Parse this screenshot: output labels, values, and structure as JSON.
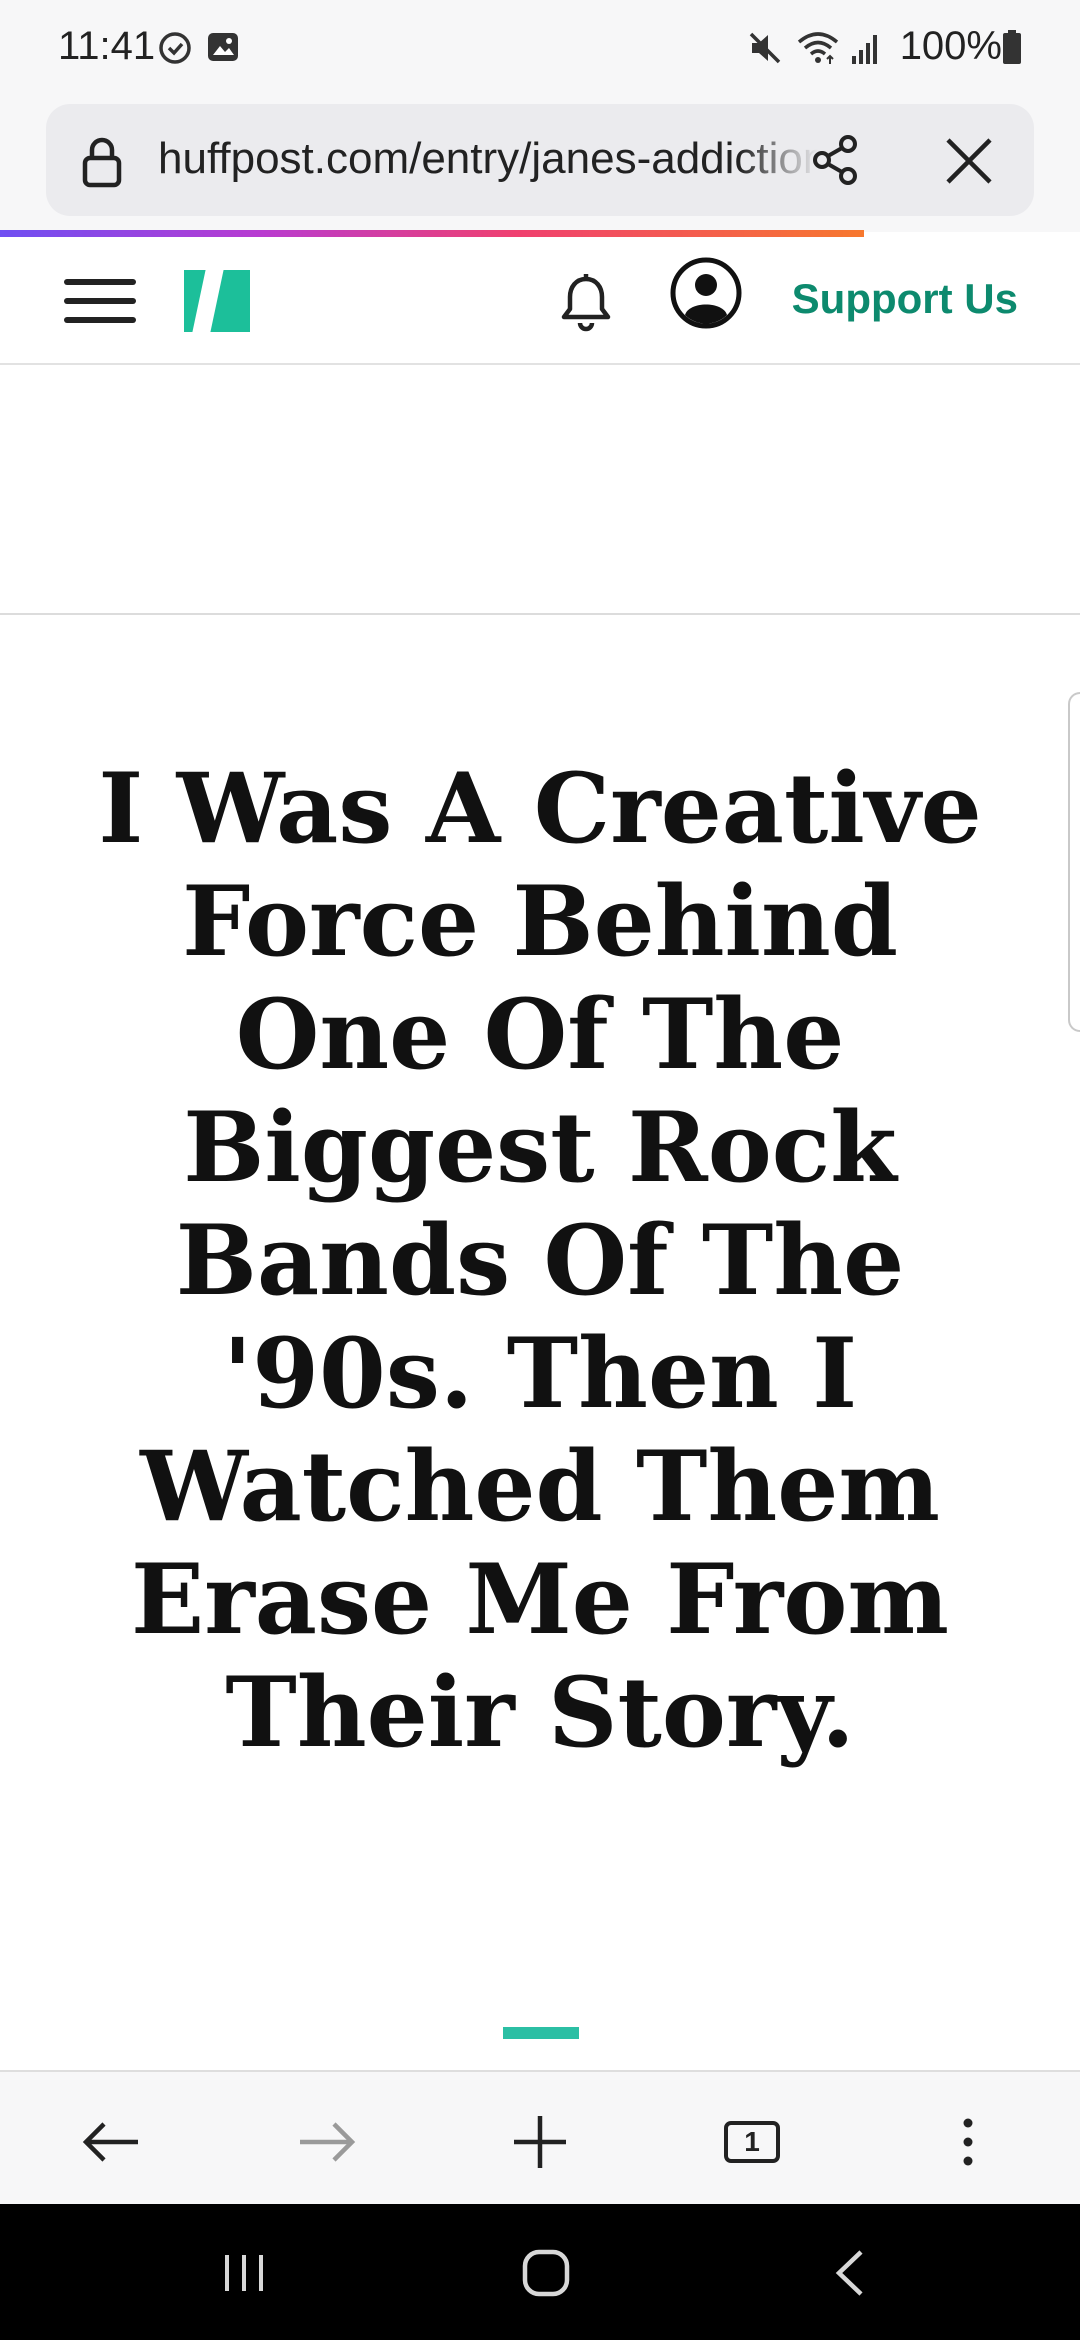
{
  "status_bar": {
    "time": "11:41",
    "battery": "100%"
  },
  "browser": {
    "url": "huffpost.com/entry/janes-addiction",
    "tab_count": "1"
  },
  "site": {
    "support_label": "Support Us",
    "brand_color": "#0d8a6e",
    "logo_color": "#1cbf9a"
  },
  "article": {
    "headline": "I Was A Creative Force Behind One Of The Biggest Rock Bands Of The '90s. Then I Watched Them Erase Me From Their Story."
  },
  "icons": {
    "status": [
      "alarm-icon",
      "gallery-icon",
      "mute-icon",
      "wifi-icon",
      "signal-icon",
      "battery-icon"
    ],
    "toolbar": [
      "back-arrow-icon",
      "forward-arrow-icon",
      "new-tab-plus-icon",
      "tabs-icon",
      "more-vert-icon"
    ],
    "nav": [
      "recents-icon",
      "home-icon",
      "back-icon"
    ]
  }
}
